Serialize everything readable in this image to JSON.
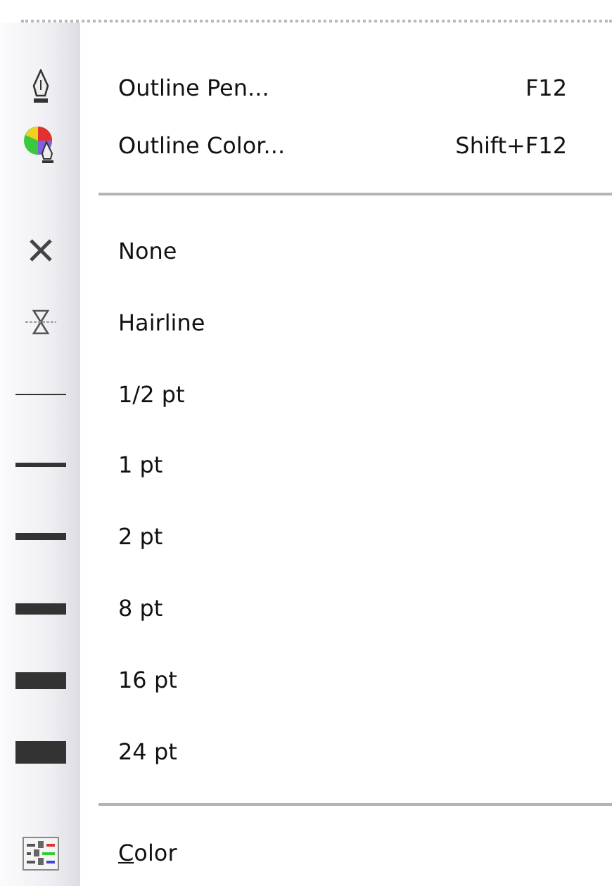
{
  "menu": {
    "items": [
      {
        "kind": "pen",
        "label": "Outline Pen...",
        "shortcut": "F12"
      },
      {
        "kind": "color-pen",
        "label": "Outline Color...",
        "shortcut": "Shift+F12"
      },
      {
        "kind": "separator"
      },
      {
        "kind": "none",
        "label": "None"
      },
      {
        "kind": "hairline",
        "label": "Hairline"
      },
      {
        "kind": "line",
        "label": "1/2 pt"
      },
      {
        "kind": "line",
        "label": "1 pt"
      },
      {
        "kind": "line",
        "label": "2 pt"
      },
      {
        "kind": "line",
        "label": "8 pt"
      },
      {
        "kind": "line",
        "label": "16 pt"
      },
      {
        "kind": "line",
        "label": "24 pt"
      },
      {
        "kind": "separator"
      },
      {
        "kind": "palette",
        "label": "Color",
        "mnemonic_underlined": true
      }
    ]
  }
}
